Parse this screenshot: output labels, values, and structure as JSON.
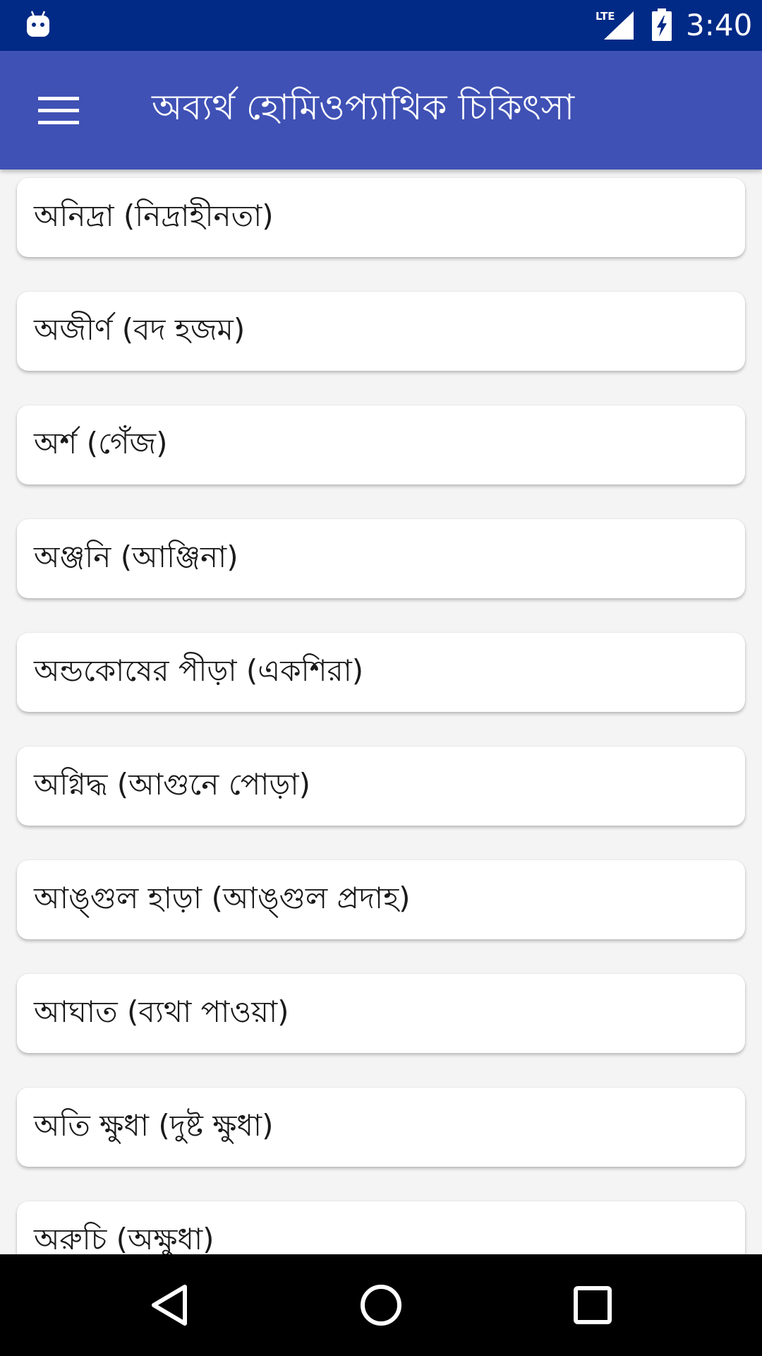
{
  "status_bar": {
    "time": "3:40",
    "network_label": "LTE",
    "icons": [
      "android-robot-icon",
      "lte-signal-icon",
      "battery-charging-icon"
    ]
  },
  "app_bar": {
    "menu_icon": "hamburger-menu-icon",
    "title": "অব্যর্থ হোমিওপ্যাথিক চিকিৎসা",
    "background": "#3f51b5"
  },
  "list": {
    "items": [
      {
        "label": "অনিদ্রা (নিদ্রাহীনতা)"
      },
      {
        "label": "অজীর্ণ (বদ হজম)"
      },
      {
        "label": "অর্শ (গেঁজ)"
      },
      {
        "label": "অঞ্জনি (আঞ্জিনা)"
      },
      {
        "label": "অন্ডকোষের পীড়া (একশিরা)"
      },
      {
        "label": "অগ্নিদ্ধ (আগুনে পোড়া)"
      },
      {
        "label": "আঙ্গুল হাড়া (আঙ্গুল প্রদাহ)"
      },
      {
        "label": "আঘাত (ব্যথা পাওয়া)"
      },
      {
        "label": "অতি ক্ষুধা (দুষ্ট ক্ষুধা)"
      },
      {
        "label": "অরুচি (অক্ষুধা)"
      }
    ]
  },
  "nav_bar": {
    "buttons": [
      "back-icon",
      "home-icon",
      "recents-icon"
    ]
  },
  "colors": {
    "status_bar": "#012a86",
    "app_bar": "#3f51b5",
    "background": "#f4f4f4",
    "card": "#ffffff",
    "nav_bar": "#000000"
  }
}
